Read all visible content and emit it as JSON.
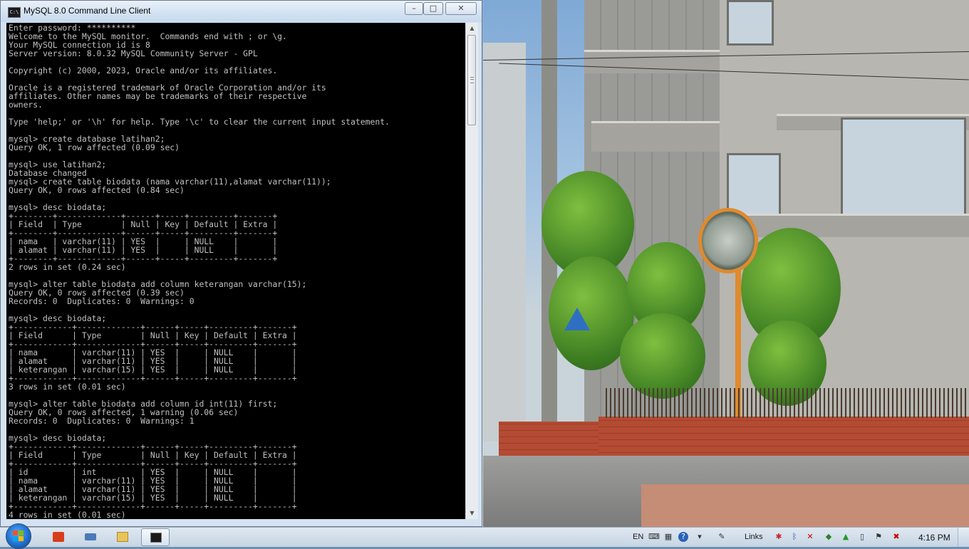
{
  "window": {
    "title": "MySQL 8.0 Command Line Client",
    "icon": "mysql-console-icon",
    "controls": {
      "minimize": "minimize-icon",
      "maximize": "maximize-icon",
      "close": "close-icon"
    }
  },
  "console": {
    "background": "#000000",
    "foreground": "#c0c0c0",
    "text": "Enter password: **********\nWelcome to the MySQL monitor.  Commands end with ; or \\g.\nYour MySQL connection id is 8\nServer version: 8.0.32 MySQL Community Server - GPL\n\nCopyright (c) 2000, 2023, Oracle and/or its affiliates.\n\nOracle is a registered trademark of Oracle Corporation and/or its\naffiliates. Other names may be trademarks of their respective\nowners.\n\nType 'help;' or '\\h' for help. Type '\\c' to clear the current input statement.\n\nmysql> create database latihan2;\nQuery OK, 1 row affected (0.09 sec)\n\nmysql> use latihan2;\nDatabase changed\nmysql> create table biodata (nama varchar(11),alamat varchar(11));\nQuery OK, 0 rows affected (0.84 sec)\n\nmysql> desc biodata;\n+--------+-------------+------+-----+---------+-------+\n| Field  | Type        | Null | Key | Default | Extra |\n+--------+-------------+------+-----+---------+-------+\n| nama   | varchar(11) | YES  |     | NULL    |       |\n| alamat | varchar(11) | YES  |     | NULL    |       |\n+--------+-------------+------+-----+---------+-------+\n2 rows in set (0.24 sec)\n\nmysql> alter table biodata add column keterangan varchar(15);\nQuery OK, 0 rows affected (0.39 sec)\nRecords: 0  Duplicates: 0  Warnings: 0\n\nmysql> desc biodata;\n+------------+-------------+------+-----+---------+-------+\n| Field      | Type        | Null | Key | Default | Extra |\n+------------+-------------+------+-----+---------+-------+\n| nama       | varchar(11) | YES  |     | NULL    |       |\n| alamat     | varchar(11) | YES  |     | NULL    |       |\n| keterangan | varchar(15) | YES  |     | NULL    |       |\n+------------+-------------+------+-----+---------+-------+\n3 rows in set (0.01 sec)\n\nmysql> alter table biodata add column id int(11) first;\nQuery OK, 0 rows affected, 1 warning (0.06 sec)\nRecords: 0  Duplicates: 0  Warnings: 1\n\nmysql> desc biodata;\n+------------+-------------+------+-----+---------+-------+\n| Field      | Type        | Null | Key | Default | Extra |\n+------------+-------------+------+-----+---------+-------+\n| id         | int         | YES  |     | NULL    |       |\n| nama       | varchar(11) | YES  |     | NULL    |       |\n| alamat     | varchar(11) | YES  |     | NULL    |       |\n| keterangan | varchar(15) | YES  |     | NULL    |       |\n+------------+-------------+------+-----+---------+-------+\n4 rows in set (0.01 sec)"
  },
  "scrollbar": {
    "up": "scroll-up-arrow-icon",
    "down": "scroll-down-arrow-icon"
  },
  "taskbar": {
    "start": "windows-start-icon",
    "pinned": [
      {
        "name": "office-app-icon"
      },
      {
        "name": "keyboard-icon"
      },
      {
        "name": "file-explorer-icon"
      },
      {
        "name": "mysql-console-icon",
        "active": true
      }
    ],
    "tray": {
      "language": "EN",
      "links_label": "Links",
      "clock": "4:16 PM",
      "icons": [
        "keyboard-tray-icon",
        "help-icon",
        "connection-icon",
        "notes-icon",
        "network-app-icon",
        "bluetooth-icon",
        "volume-muted-icon",
        "security-icon",
        "warning-icon",
        "battery-icon",
        "action-center-flag-icon",
        "network-disconnected-icon"
      ]
    }
  }
}
